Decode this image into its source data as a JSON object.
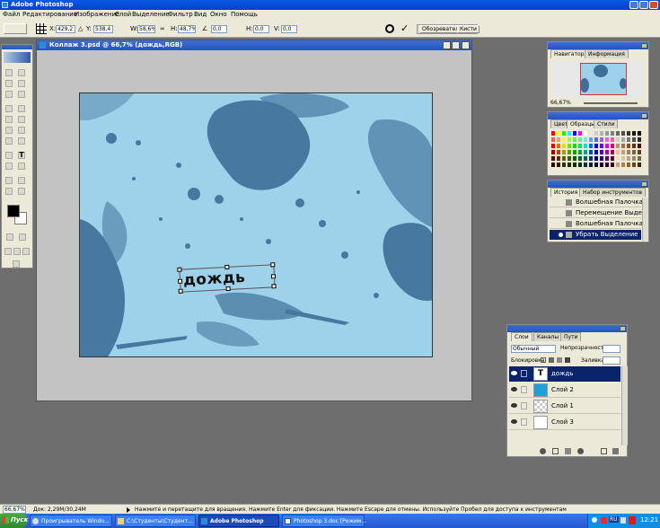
{
  "app": {
    "title": "Adobe Photoshop"
  },
  "menu": [
    "Файл",
    "Редактирование",
    "Изображение",
    "Слой",
    "Выделение",
    "Фильтр",
    "Вид",
    "Окно",
    "Помощь"
  ],
  "options": {
    "x_label": "X:",
    "x_value": "429,2",
    "y_label": "Y:",
    "y_value": "538,4",
    "w_label": "W:",
    "w_value": "58,6%",
    "h_label": "H:",
    "h_value": "48,7%",
    "angle_value": "0,0",
    "hskew_label": "H:",
    "hskew_value": "0,0",
    "vskew_label": "V:",
    "vskew_value": "0,0",
    "tab_browser": "Обозреватель",
    "tab_brushes": "Кисти"
  },
  "document": {
    "title": "Коллаж 3.psd @ 66,7% (дождь,RGB)",
    "text": "дождь"
  },
  "navigator": {
    "tab1": "Навигатор",
    "tab2": "Информация",
    "zoom": "66,67%"
  },
  "swatches": {
    "tab1": "Цвет",
    "tab2": "Образцы",
    "tab3": "Стили",
    "colors": [
      "#ff0000",
      "#ffff00",
      "#00ff00",
      "#00ffff",
      "#0000ff",
      "#ff00ff",
      "#ffffff",
      "#e6e6e6",
      "#cccccc",
      "#b3b3b3",
      "#999999",
      "#808080",
      "#666666",
      "#4d4d4d",
      "#333333",
      "#1a1a1a",
      "#000000",
      "#f06060",
      "#f0a060",
      "#f0f060",
      "#a0f060",
      "#60f060",
      "#60f0a0",
      "#60f0f0",
      "#60a0f0",
      "#6060f0",
      "#a060f0",
      "#f060f0",
      "#f060a0",
      "#d0d0d0",
      "#a8a8a8",
      "#787878",
      "#505050",
      "#282828",
      "#e00000",
      "#e07000",
      "#e0e000",
      "#70e000",
      "#00e000",
      "#00e070",
      "#00e0e0",
      "#0070e0",
      "#0000e0",
      "#7000e0",
      "#e000e0",
      "#e00070",
      "#c09070",
      "#a07050",
      "#805030",
      "#603010",
      "#401000",
      "#a00000",
      "#a05000",
      "#a0a000",
      "#50a000",
      "#00a000",
      "#00a050",
      "#00a0a0",
      "#0050a0",
      "#0000a0",
      "#5000a0",
      "#a000a0",
      "#a00050",
      "#e0c0a0",
      "#c0a080",
      "#a08060",
      "#806040",
      "#604020",
      "#600000",
      "#603000",
      "#606000",
      "#306000",
      "#006000",
      "#006030",
      "#006060",
      "#003060",
      "#000060",
      "#300060",
      "#600060",
      "#600030",
      "#f0e0c0",
      "#d8c8a8",
      "#b8a888",
      "#988868",
      "#786848",
      "#300000",
      "#301800",
      "#303000",
      "#183000",
      "#003000",
      "#003018",
      "#003030",
      "#001830",
      "#000030",
      "#180030",
      "#300030",
      "#300018",
      "#c8a070",
      "#b08050",
      "#906030",
      "#704010",
      "#502000"
    ]
  },
  "history": {
    "tab1": "История",
    "tab2": "Набор инструментов",
    "items": [
      "Волшебная Палочка",
      "Перемещение Выде...",
      "Волшебная Палочка",
      "Убрать Выделение"
    ]
  },
  "layers": {
    "tab1": "Слои",
    "tab2": "Каналы",
    "tab3": "Пути",
    "mode": "Обычный",
    "opacity_label": "Непрозрачность:",
    "lock_label": "Блокировка:",
    "fill_label": "Заливка:",
    "items": [
      {
        "name": "дождь",
        "type": "text",
        "selected": true
      },
      {
        "name": "Слой 2",
        "color": "#1ea0d8"
      },
      {
        "name": "Слой 1",
        "type": "checker"
      },
      {
        "name": "Слой 3",
        "color": "#ffffff"
      }
    ]
  },
  "status": {
    "zoom": "66,67%",
    "doc": "Док: 2,29M/30,24M",
    "hint": "Нажмите и перетащите для вращения. Нажмите Enter для фиксации. Нажмите Escape для отмены. Используйте Пробел для доступа к инструментам"
  },
  "taskbar": {
    "start": "Пуск",
    "items": [
      "Проигрыватель Windo...",
      "C:\\Студенты\\Студент...",
      "Adobe Photoshop",
      "Photoshop 3.doc [Режим..."
    ],
    "lang": "RU",
    "time": "12:21"
  }
}
